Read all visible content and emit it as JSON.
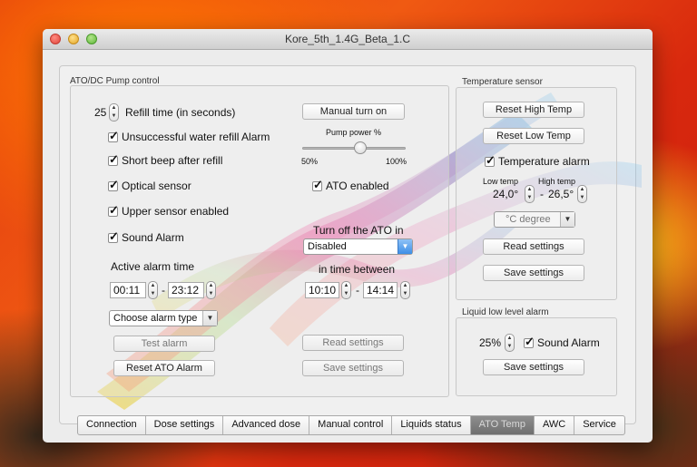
{
  "window": {
    "title": "Kore_5th_1.4G_Beta_1.C"
  },
  "ato": {
    "group_label": "ATO/DC Pump control",
    "refill_value": "25",
    "refill_label": "Refill time (in seconds)",
    "checkboxes": [
      {
        "label": "Unsuccessful water refill Alarm",
        "checked": true
      },
      {
        "label": "Short beep after refill",
        "checked": true
      },
      {
        "label": "Optical sensor",
        "checked": true
      },
      {
        "label": "Upper sensor enabled",
        "checked": true
      },
      {
        "label": "Sound Alarm",
        "checked": true
      }
    ],
    "manual_turn_on": "Manual turn on",
    "pump_power_label": "Pump power %",
    "pump_min": "50%",
    "pump_max": "100%",
    "pump_power_fraction": 0.56,
    "ato_enabled": {
      "label": "ATO enabled",
      "checked": true
    },
    "active_alarm_label": "Active alarm time",
    "alarm_from": "00:11",
    "alarm_sep": "-",
    "alarm_to": "23:12",
    "turn_off_label": "Turn off the ATO in",
    "turn_off_value": "Disabled",
    "between_label": "in time between",
    "between_from": "10:10",
    "between_sep": "-",
    "between_to": "14:14",
    "alarm_type_value": "Choose alarm type",
    "test_alarm": "Test alarm",
    "reset_alarm": "Reset ATO Alarm",
    "read_settings": "Read settings",
    "save_settings": "Save settings"
  },
  "temp": {
    "group_label": "Temperature sensor",
    "reset_high": "Reset High Temp",
    "reset_low": "Reset Low Temp",
    "alarm": {
      "label": "Temperature alarm",
      "checked": true
    },
    "low_label": "Low temp",
    "high_label": "High temp",
    "low_value": "24,0°",
    "dash": "-",
    "high_value": "26,5°",
    "unit_value": "°C degree",
    "read_settings": "Read settings",
    "save_settings": "Save settings"
  },
  "liquid": {
    "group_label": "Liquid low level alarm",
    "percent": "25%",
    "sound": {
      "label": "Sound Alarm",
      "checked": true
    },
    "save_settings": "Save settings"
  },
  "tabs": [
    {
      "label": "Connection"
    },
    {
      "label": "Dose settings"
    },
    {
      "label": "Advanced dose"
    },
    {
      "label": "Manual control"
    },
    {
      "label": "Liquids status"
    },
    {
      "label": "ATO Temp",
      "active": true
    },
    {
      "label": "AWC"
    },
    {
      "label": "Service"
    }
  ],
  "colors": {
    "accent_blue": "#3d8ee6",
    "active_tab": "#7a7a7a"
  }
}
